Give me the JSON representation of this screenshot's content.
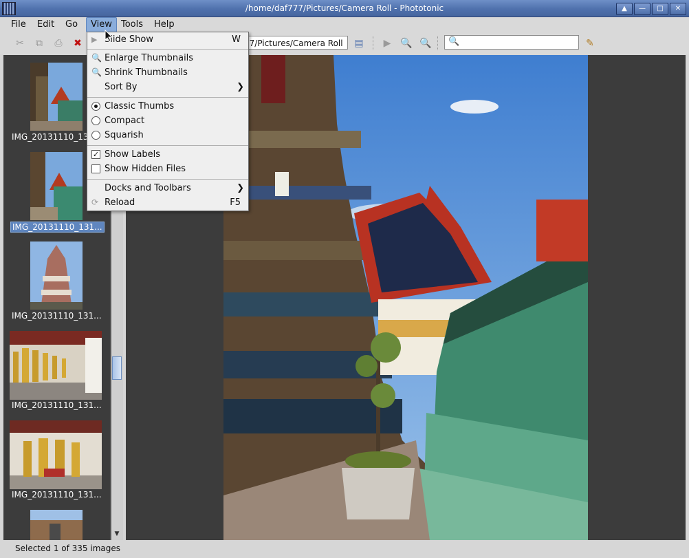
{
  "window": {
    "title": "/home/daf777/Pictures/Camera Roll - Phototonic"
  },
  "menubar": {
    "items": [
      "File",
      "Edit",
      "Go",
      "View",
      "Tools",
      "Help"
    ]
  },
  "toolbar": {
    "path": "77/Pictures/Camera Roll",
    "search_placeholder": ""
  },
  "thumbnails": [
    {
      "label": "IMG_20131110_131"
    },
    {
      "label": "IMG_20131110_131..."
    },
    {
      "label": "IMG_20131110_131..."
    },
    {
      "label": "IMG_20131110_131..."
    },
    {
      "label": "IMG_20131110_131..."
    }
  ],
  "view_menu": {
    "slide_show": {
      "label": "Slide Show",
      "shortcut": "W"
    },
    "enlarge": "Enlarge Thumbnails",
    "shrink": "Shrink Thumbnails",
    "sort_by": "Sort By",
    "classic": "Classic Thumbs",
    "compact": "Compact",
    "squarish": "Squarish",
    "show_labels": "Show Labels",
    "show_hidden": "Show Hidden Files",
    "docks": "Docks and Toolbars",
    "reload": {
      "label": "Reload",
      "shortcut": "F5"
    },
    "selected_layout": "Classic Thumbs",
    "show_labels_checked": true,
    "show_hidden_checked": false
  },
  "status": {
    "text": "Selected 1 of 335 images"
  },
  "colors": {
    "titlebar": "#4f71ad",
    "selection": "#5f86bf",
    "panel": "#3c3c3c"
  }
}
